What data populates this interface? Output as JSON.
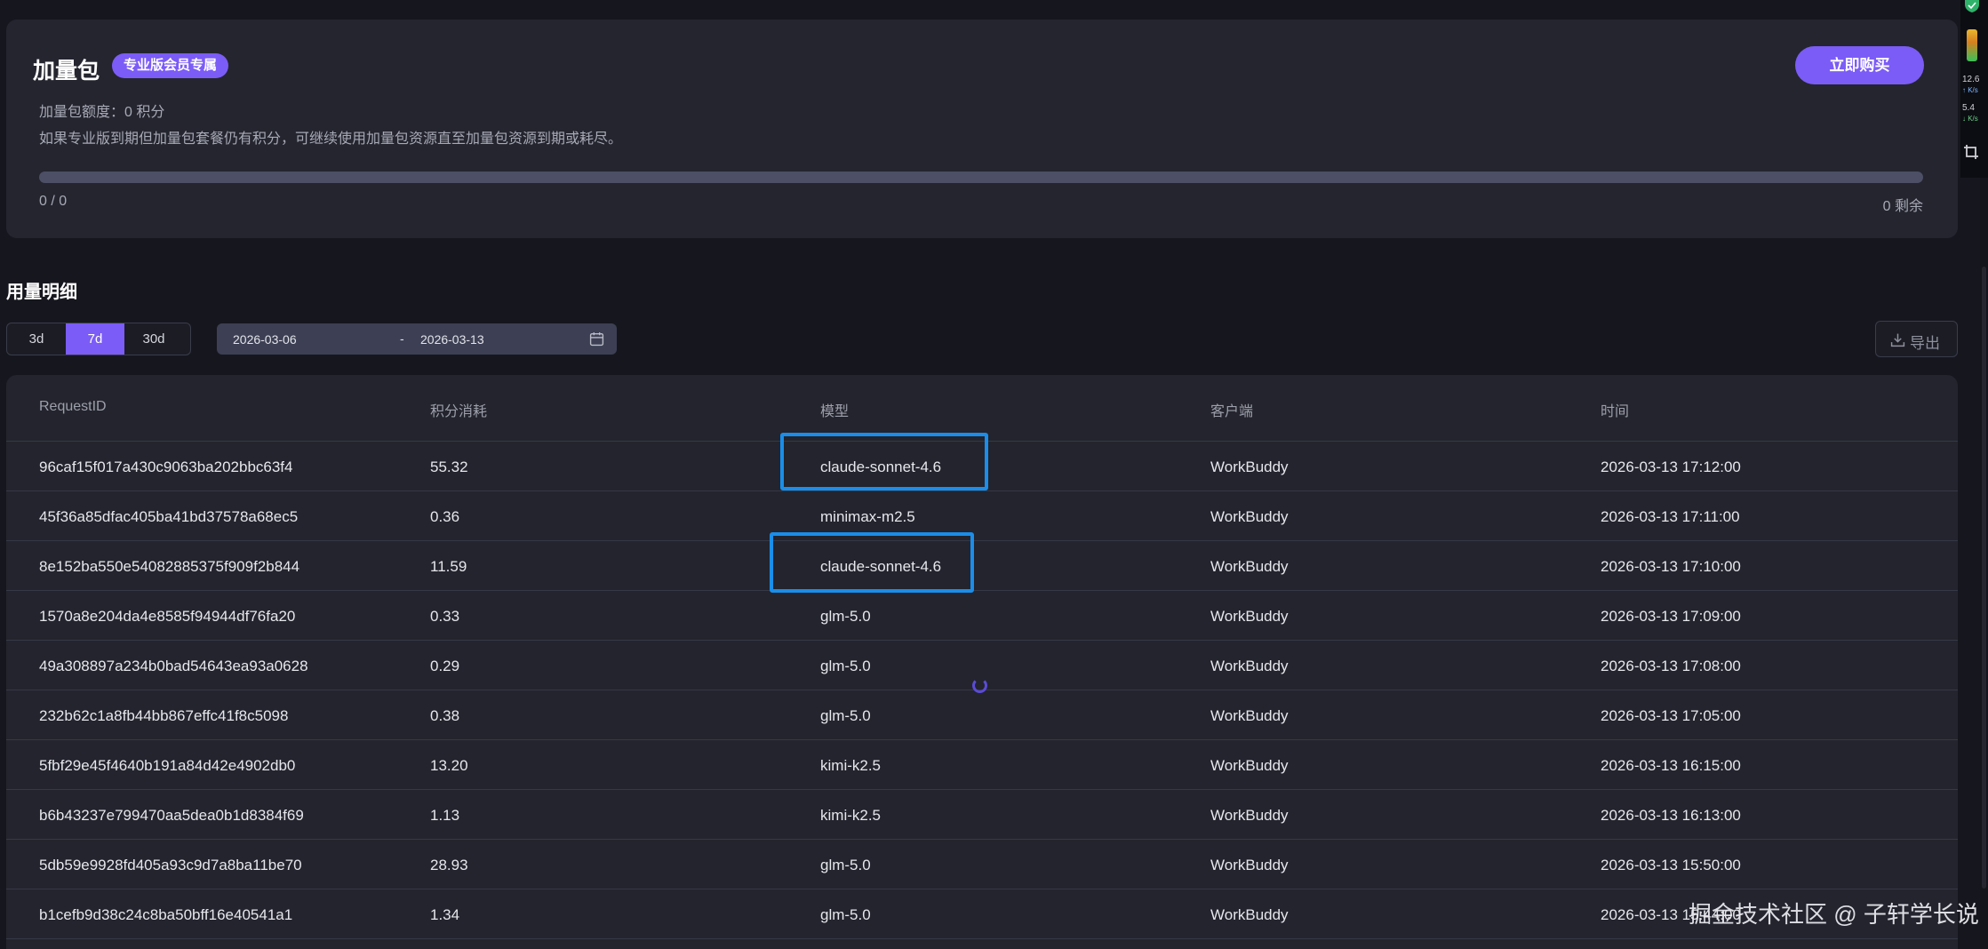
{
  "addon": {
    "title": "加量包",
    "badge": "专业版会员专属",
    "quota_text": "加量包额度：0 积分",
    "note": "如果专业版到期但加量包套餐仍有积分，可继续使用加量包资源直至加量包资源到期或耗尽。",
    "buy_label": "立即购买",
    "progress_fraction": 0,
    "used_text": "0 / 0",
    "remaining_text": "0 剩余"
  },
  "usage": {
    "title": "用量明细",
    "ranges": [
      "3d",
      "7d",
      "30d"
    ],
    "active_range": "7d",
    "date_start": "2026-03-06",
    "date_separator": "-",
    "date_end": "2026-03-13",
    "export_label": "导出"
  },
  "table": {
    "columns": [
      "RequestID",
      "积分消耗",
      "模型",
      "客户端",
      "时间"
    ],
    "rows": [
      [
        "96caf15f017a430c9063ba202bbc63f4",
        "55.32",
        "claude-sonnet-4.6",
        "WorkBuddy",
        "2026-03-13 17:12:00"
      ],
      [
        "45f36a85dfac405ba41bd37578a68ec5",
        "0.36",
        "minimax-m2.5",
        "WorkBuddy",
        "2026-03-13 17:11:00"
      ],
      [
        "8e152ba550e54082885375f909f2b844",
        "11.59",
        "claude-sonnet-4.6",
        "WorkBuddy",
        "2026-03-13 17:10:00"
      ],
      [
        "1570a8e204da4e8585f94944df76fa20",
        "0.33",
        "glm-5.0",
        "WorkBuddy",
        "2026-03-13 17:09:00"
      ],
      [
        "49a308897a234b0bad54643ea93a0628",
        "0.29",
        "glm-5.0",
        "WorkBuddy",
        "2026-03-13 17:08:00"
      ],
      [
        "232b62c1a8fb44bb867effc41f8c5098",
        "0.38",
        "glm-5.0",
        "WorkBuddy",
        "2026-03-13 17:05:00"
      ],
      [
        "5fbf29e45f4640b191a84d42e4902db0",
        "13.20",
        "kimi-k2.5",
        "WorkBuddy",
        "2026-03-13 16:15:00"
      ],
      [
        "b6b43237e799470aa5dea0b1d8384f69",
        "1.13",
        "kimi-k2.5",
        "WorkBuddy",
        "2026-03-13 16:13:00"
      ],
      [
        "5db59e9928fd405a93c9d7a8ba11be70",
        "28.93",
        "glm-5.0",
        "WorkBuddy",
        "2026-03-13 15:50:00"
      ],
      [
        "b1cefb9d38c24c8ba50bff16e40541a1",
        "1.34",
        "glm-5.0",
        "WorkBuddy",
        "2026-03-13 15:44:00"
      ]
    ],
    "highlighted_rows": [
      0,
      2
    ]
  },
  "watermark": "掘金技术社区 @ 子轩学长说",
  "system_tray": {
    "upload_speed": "12.6",
    "upload_unit": "↑ K/s",
    "download_speed": "5.4",
    "download_unit": "↓ K/s"
  },
  "colors": {
    "accent": "#7b5cf6",
    "highlight_box": "#1a8eea",
    "card_bg": "#24252f",
    "page_bg": "#16171e"
  }
}
